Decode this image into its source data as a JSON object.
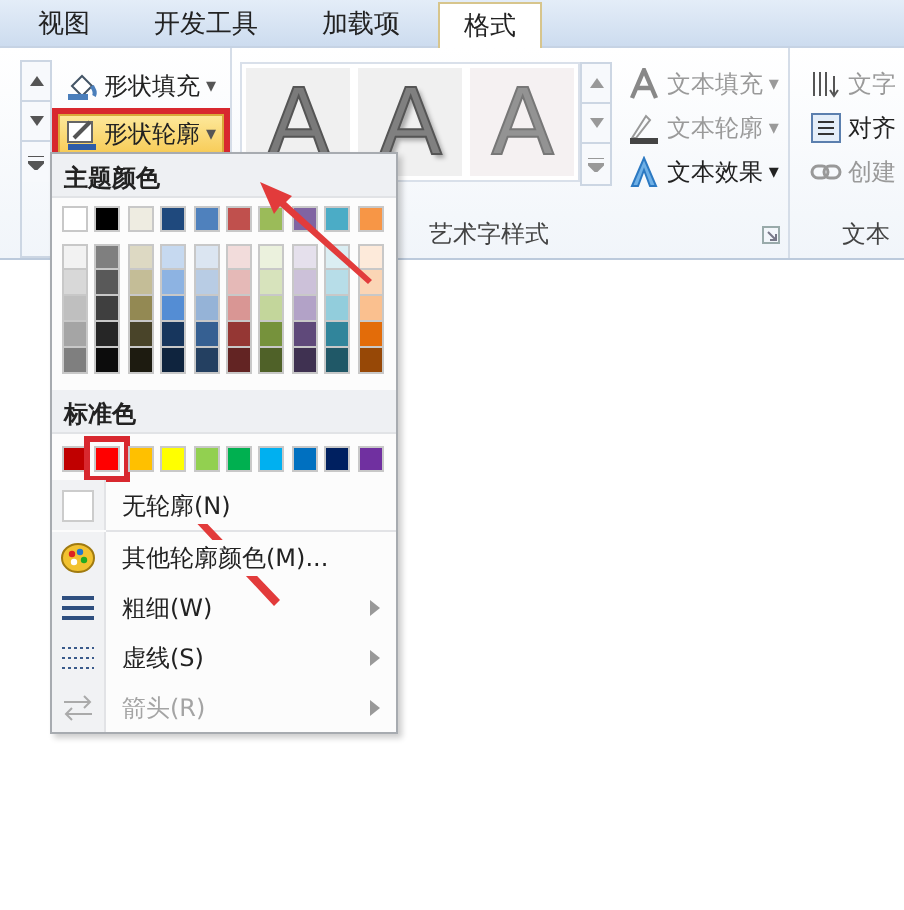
{
  "tabs": [
    {
      "label": "视图",
      "selected": false
    },
    {
      "label": "开发工具",
      "selected": false
    },
    {
      "label": "加载项",
      "selected": false
    },
    {
      "label": "格式",
      "selected": true
    }
  ],
  "shape_buttons": [
    {
      "label": "形状填充",
      "dropdown": "▾",
      "highlighted": false
    },
    {
      "label": "形状轮廓",
      "dropdown": "▾",
      "highlighted": true
    }
  ],
  "wordart_gallery": [
    {
      "text": "A",
      "kind": "outline"
    },
    {
      "text": "A",
      "kind": "shadow"
    },
    {
      "text": "A",
      "kind": "faint"
    }
  ],
  "text_buttons": [
    {
      "label": "文本填充",
      "dropdown": "▾",
      "disabled": true
    },
    {
      "label": "文本轮廓",
      "dropdown": "▾",
      "disabled": true
    },
    {
      "label": "文本效果",
      "dropdown": "▾",
      "disabled": false
    }
  ],
  "wordart_group_label": "艺术字样式",
  "text_group_buttons": [
    {
      "label": "文字",
      "disabled": true
    },
    {
      "label": "对齐",
      "disabled": false
    },
    {
      "label": "创建",
      "disabled": true
    }
  ],
  "text_group_label": "文本",
  "outline_menu": {
    "theme_heading": "主题颜色",
    "theme_colors": [
      {
        "color": "#ffffff",
        "selected": false,
        "shades": [
          {
            "color": "#f2f2f2",
            "selected": false
          },
          {
            "color": "#d8d8d8",
            "selected": false
          },
          {
            "color": "#bfbfbf",
            "selected": false
          },
          {
            "color": "#a5a5a5",
            "selected": false
          },
          {
            "color": "#7f7f7f",
            "selected": false
          }
        ]
      },
      {
        "color": "#000000",
        "selected": false,
        "shades": [
          {
            "color": "#7f7f7f",
            "selected": false
          },
          {
            "color": "#595959",
            "selected": false
          },
          {
            "color": "#3f3f3f",
            "selected": false
          },
          {
            "color": "#262626",
            "selected": false
          },
          {
            "color": "#0c0c0c",
            "selected": false
          }
        ]
      },
      {
        "color": "#eeece1",
        "selected": false,
        "shades": [
          {
            "color": "#ddd9c3",
            "selected": false
          },
          {
            "color": "#c4bd97",
            "selected": false
          },
          {
            "color": "#938953",
            "selected": false
          },
          {
            "color": "#494429",
            "selected": false
          },
          {
            "color": "#1d1b10",
            "selected": false
          }
        ]
      },
      {
        "color": "#1f497d",
        "selected": false,
        "shades": [
          {
            "color": "#c6d9f0",
            "selected": false
          },
          {
            "color": "#8db3e2",
            "selected": false
          },
          {
            "color": "#548dd4",
            "selected": false
          },
          {
            "color": "#17365d",
            "selected": false
          },
          {
            "color": "#0f243e",
            "selected": false
          }
        ]
      },
      {
        "color": "#4f81bd",
        "selected": false,
        "shades": [
          {
            "color": "#dbe5f1",
            "selected": false
          },
          {
            "color": "#b8cce4",
            "selected": false
          },
          {
            "color": "#95b3d7",
            "selected": false
          },
          {
            "color": "#366092",
            "selected": false
          },
          {
            "color": "#244061",
            "selected": false
          }
        ]
      },
      {
        "color": "#c0504d",
        "selected": false,
        "shades": [
          {
            "color": "#f2dcdb",
            "selected": false
          },
          {
            "color": "#e5b9b7",
            "selected": false
          },
          {
            "color": "#d99694",
            "selected": false
          },
          {
            "color": "#953734",
            "selected": false
          },
          {
            "color": "#632423",
            "selected": false
          }
        ]
      },
      {
        "color": "#9bbb59",
        "selected": false,
        "shades": [
          {
            "color": "#ebf1dd",
            "selected": false
          },
          {
            "color": "#d7e3bc",
            "selected": false
          },
          {
            "color": "#c3d69b",
            "selected": false
          },
          {
            "color": "#76923c",
            "selected": false
          },
          {
            "color": "#4f6128",
            "selected": false
          }
        ]
      },
      {
        "color": "#8064a2",
        "selected": false,
        "shades": [
          {
            "color": "#e5e0ec",
            "selected": false
          },
          {
            "color": "#ccc1d9",
            "selected": false
          },
          {
            "color": "#b2a2c7",
            "selected": false
          },
          {
            "color": "#5f497a",
            "selected": false
          },
          {
            "color": "#3f3151",
            "selected": false
          }
        ]
      },
      {
        "color": "#4bacc6",
        "selected": false,
        "shades": [
          {
            "color": "#dbeef3",
            "selected": false
          },
          {
            "color": "#b7dde8",
            "selected": false
          },
          {
            "color": "#92cddc",
            "selected": false
          },
          {
            "color": "#31859b",
            "selected": false
          },
          {
            "color": "#205867",
            "selected": false
          }
        ]
      },
      {
        "color": "#f79646",
        "selected": false,
        "shades": [
          {
            "color": "#fdeada",
            "selected": false
          },
          {
            "color": "#fbd5b5",
            "selected": false
          },
          {
            "color": "#fac08f",
            "selected": false
          },
          {
            "color": "#e36c09",
            "selected": false
          },
          {
            "color": "#974806",
            "selected": false
          }
        ]
      }
    ],
    "standard_heading": "标准色",
    "standard_colors": [
      {
        "color": "#c00000",
        "selected": false
      },
      {
        "color": "#ff0000",
        "selected": true
      },
      {
        "color": "#ffc000",
        "selected": false
      },
      {
        "color": "#ffff00",
        "selected": false
      },
      {
        "color": "#92d050",
        "selected": false
      },
      {
        "color": "#00b050",
        "selected": false
      },
      {
        "color": "#00b0f0",
        "selected": false
      },
      {
        "color": "#0070c0",
        "selected": false
      },
      {
        "color": "#002060",
        "selected": false
      },
      {
        "color": "#7030a0",
        "selected": false
      }
    ],
    "items": [
      {
        "label": "无轮廓(N)",
        "submenu": false,
        "disabled": false
      },
      {
        "label": "其他轮廓颜色(M)...",
        "submenu": false,
        "disabled": false
      },
      {
        "label": "粗细(W)",
        "submenu": true,
        "disabled": false
      },
      {
        "label": "虚线(S)",
        "submenu": true,
        "disabled": false
      },
      {
        "label": "箭头(R)",
        "submenu": true,
        "disabled": true
      }
    ]
  }
}
